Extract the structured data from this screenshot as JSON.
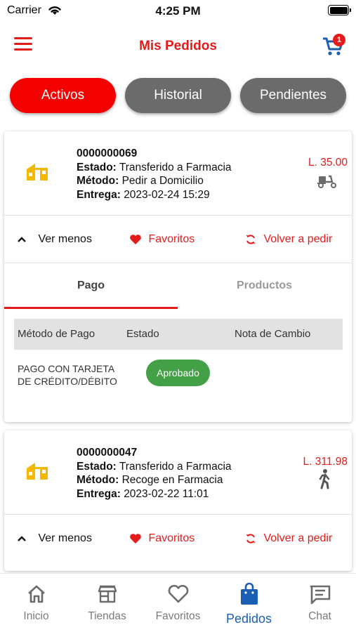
{
  "status_bar": {
    "carrier": "Carrier",
    "time": "4:25 PM"
  },
  "header": {
    "title": "Mis Pedidos",
    "cart_count": "1"
  },
  "tabs": [
    {
      "label": "Activos",
      "active": true
    },
    {
      "label": "Historial",
      "active": false
    },
    {
      "label": "Pendientes",
      "active": false
    }
  ],
  "labels": {
    "estado": "Estado:",
    "metodo": "Método:",
    "entrega": "Entrega:"
  },
  "orders": [
    {
      "number": "0000000069",
      "estado": "Transferido a Farmacia",
      "metodo": "Pedir a Domicilio",
      "entrega": "2023-02-24 15:29",
      "price": "L. 35.00",
      "delivery_icon": "scooter-icon",
      "actions": {
        "toggle": "Ver menos",
        "favorites": "Favoritos",
        "reorder": "Volver a pedir"
      },
      "detail_tabs": [
        "Pago",
        "Productos"
      ],
      "payment": {
        "headers": [
          "Método de Pago",
          "Estado",
          "Nota de Cambio"
        ],
        "method": "PAGO CON TARJETA DE CRÉDITO/DÉBITO",
        "status": "Aprobado"
      }
    },
    {
      "number": "0000000047",
      "estado": "Transferido a Farmacia",
      "metodo": "Recoge en Farmacia",
      "entrega": "2023-02-22 11:01",
      "price": "L. 311.98",
      "delivery_icon": "walking-person-icon",
      "actions": {
        "toggle": "Ver menos",
        "favorites": "Favoritos",
        "reorder": "Volver a pedir"
      }
    }
  ],
  "bottom_nav": [
    {
      "label": "Inicio",
      "icon": "home-icon"
    },
    {
      "label": "Tiendas",
      "icon": "store-icon"
    },
    {
      "label": "Favoritos",
      "icon": "heart-outline-icon"
    },
    {
      "label": "Pedidos",
      "icon": "shopping-bag-icon",
      "active": true
    },
    {
      "label": "Chat",
      "icon": "chat-icon"
    }
  ],
  "colors": {
    "brand_red": "#e41b1b",
    "active_tab": "#f40000",
    "inactive_tab": "#6b6b6b",
    "approved": "#43a046",
    "nav_active": "#1a5fb4",
    "store_icon": "#f5b800"
  }
}
